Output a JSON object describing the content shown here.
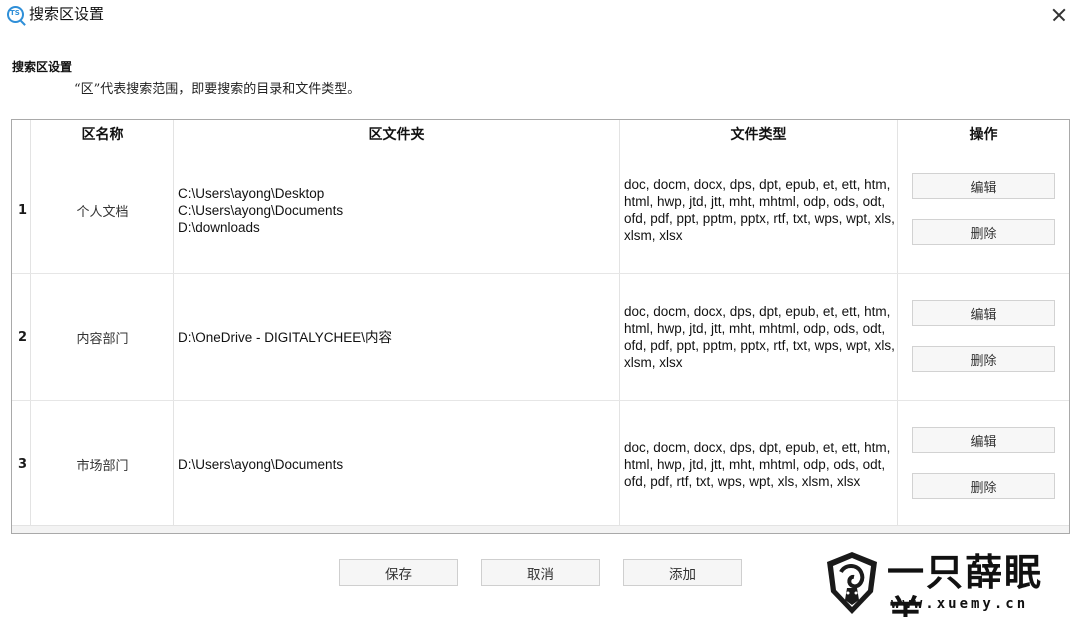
{
  "window": {
    "title": "搜索区设置",
    "icon": "ts-app-icon",
    "icon_text": "TS",
    "close_icon": "close-icon"
  },
  "section": {
    "title": "搜索区设置",
    "description": "“区”代表搜索范围，即要搜索的目录和文件类型。"
  },
  "table": {
    "headers": {
      "name": "区名称",
      "folders": "区文件夹",
      "types": "文件类型",
      "actions": "操作"
    },
    "rows": [
      {
        "num": "1",
        "name": "个人文档",
        "folders": [
          "C:\\Users\\ayong\\Desktop",
          "C:\\Users\\ayong\\Documents",
          "D:\\downloads"
        ],
        "types": "doc, docm, docx, dps, dpt, epub, et, ett, htm, html, hwp, jtd, jtt, mht, mhtml, odp, ods, odt, ofd, pdf, ppt, pptm, pptx, rtf, txt, wps, wpt, xls, xlsm, xlsx",
        "edit": "编辑",
        "delete": "删除"
      },
      {
        "num": "2",
        "name": "内容部门",
        "folders": [
          "D:\\OneDrive - DIGITALYCHEE\\内容"
        ],
        "types": "doc, docm, docx, dps, dpt, epub, et, ett, htm, html, hwp, jtd, jtt, mht, mhtml, odp, ods, odt, ofd, pdf, ppt, pptm, pptx, rtf, txt, wps, wpt, xls, xlsm, xlsx",
        "edit": "编辑",
        "delete": "删除"
      },
      {
        "num": "3",
        "name": "市场部门",
        "folders": [
          "D:\\Users\\ayong\\Documents"
        ],
        "types": "doc, docm, docx, dps, dpt, epub, et, ett, htm, html, hwp, jtd, jtt, mht, mhtml, odp, ods, odt, ofd, pdf, rtf, txt, wps, wpt, xls, xlsm, xlsx",
        "edit": "编辑",
        "delete": "删除"
      }
    ]
  },
  "footer": {
    "save": "保存",
    "cancel": "取消",
    "add": "添加"
  },
  "watermark": {
    "text": "一只薛眠羊",
    "url": "www.xuemy.cn",
    "logo": "ram-head-logo"
  },
  "colors": {
    "accent": "#2f8fd8",
    "border": "#a9a9a9",
    "button_bg": "#f7f7f7"
  }
}
